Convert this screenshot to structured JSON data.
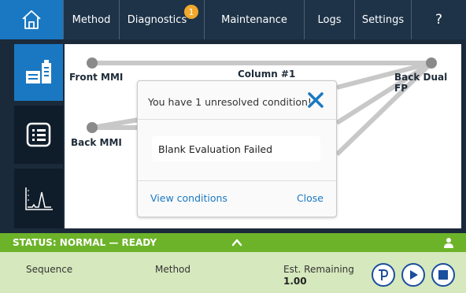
{
  "nav": {
    "items": [
      {
        "label": "Method"
      },
      {
        "label": "Diagnostics",
        "badge": "1"
      },
      {
        "label": "Maintenance"
      },
      {
        "label": "Logs"
      },
      {
        "label": "Settings"
      },
      {
        "label": "?"
      }
    ]
  },
  "sidebar": {
    "items": [
      "instrument-icon",
      "list-icon",
      "chromatogram-icon"
    ],
    "active": 0
  },
  "diagram": {
    "nodes": {
      "front": "Front MMI",
      "back": "Back MMI",
      "column": "Column #1",
      "detector": "Back Dual FP"
    }
  },
  "modal": {
    "title": "You have 1 unresolved condition!",
    "message": "Blank Evaluation Failed",
    "view_label": "View conditions",
    "close_label": "Close"
  },
  "status": {
    "text": "STATUS: NORMAL — READY",
    "color": "#6db32a"
  },
  "bottom": {
    "sequence_label": "Sequence",
    "method_label": "Method",
    "est_label": "Est. Remaining",
    "est_value": "1.00"
  },
  "colors": {
    "accent": "#1a78c2",
    "nav_bg": "#1e3348",
    "badge": "#f2a82a",
    "status_green": "#6db32a",
    "bottom_bg": "#d6e8bd"
  }
}
